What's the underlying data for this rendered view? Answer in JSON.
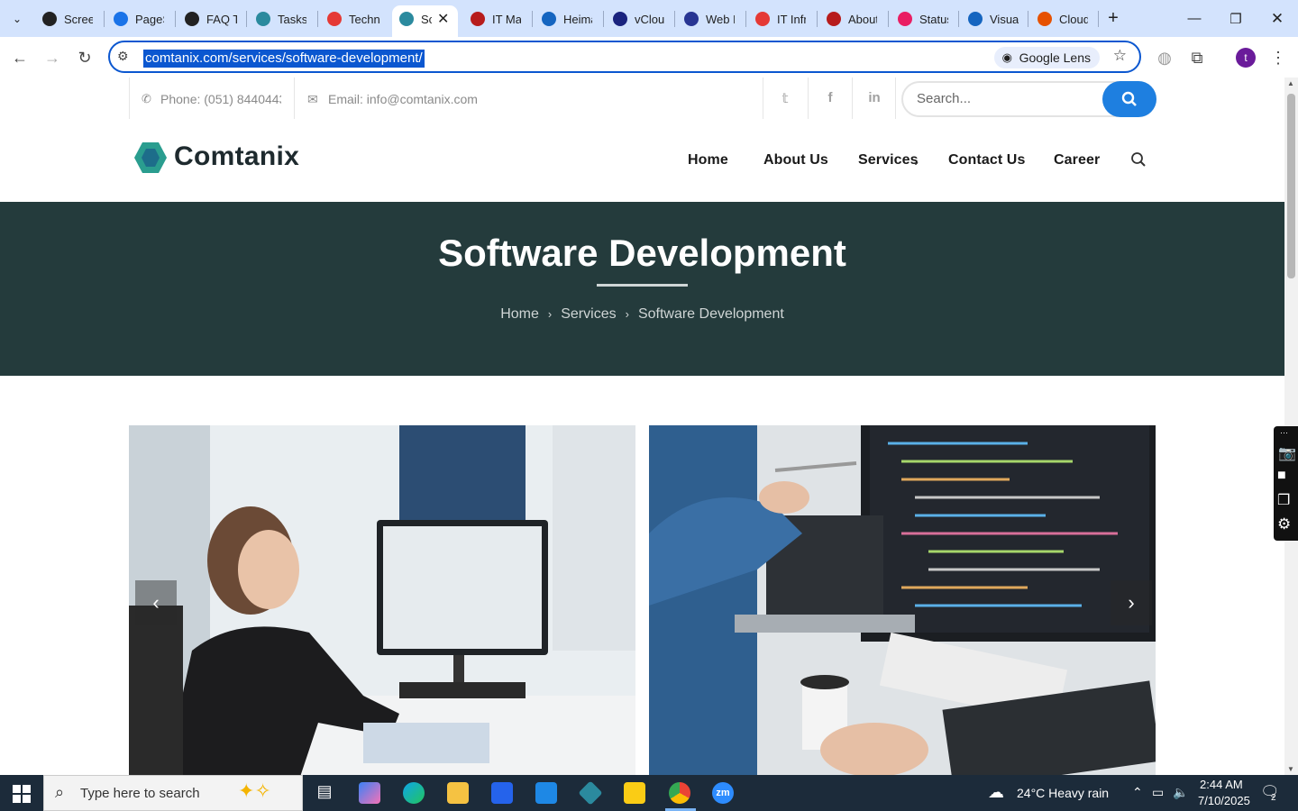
{
  "browser": {
    "tabs": [
      {
        "title": "Scree",
        "color": "#222222"
      },
      {
        "title": "PageS",
        "color": "#1a73e8"
      },
      {
        "title": "FAQ T",
        "color": "#222222"
      },
      {
        "title": "Tasks",
        "color": "#2b8a9e"
      },
      {
        "title": "Techn",
        "color": "#e53935"
      },
      {
        "title": "Sc",
        "color": "#2b8a9e"
      },
      {
        "title": "IT Ma",
        "color": "#b71c1c"
      },
      {
        "title": "Heima",
        "color": "#1565c0"
      },
      {
        "title": "vClou",
        "color": "#1a237e"
      },
      {
        "title": "Web D",
        "color": "#283593"
      },
      {
        "title": "IT Infr",
        "color": "#e53935"
      },
      {
        "title": "About",
        "color": "#b71c1c"
      },
      {
        "title": "Status",
        "color": "#e91e63"
      },
      {
        "title": "Visua",
        "color": "#1565c0"
      },
      {
        "title": "Cloud",
        "color": "#e65100"
      }
    ],
    "url": "comtanix.com/services/software-development/",
    "lens_label": "Google Lens",
    "profile_initial": "t"
  },
  "site": {
    "phone": "Phone: (051) 8440443",
    "email": "Email: info@comtanix.com",
    "search_placeholder": "Search...",
    "brand": "Comtanix",
    "nav": [
      "Home",
      "About Us",
      "Services",
      "Contact Us",
      "Career"
    ],
    "hero_title": "Software Development",
    "breadcrumb": [
      "Home",
      "Services",
      "Software Development"
    ]
  },
  "taskbar": {
    "search_placeholder": "Type here to search",
    "weather": "24°C  Heavy rain",
    "time": "2:44 AM",
    "date": "7/10/2025",
    "notifications": "2"
  },
  "colors": {
    "hero_bg": "#243b3c",
    "accent": "#1e7fe0",
    "tab_strip": "#d3e3fd"
  }
}
